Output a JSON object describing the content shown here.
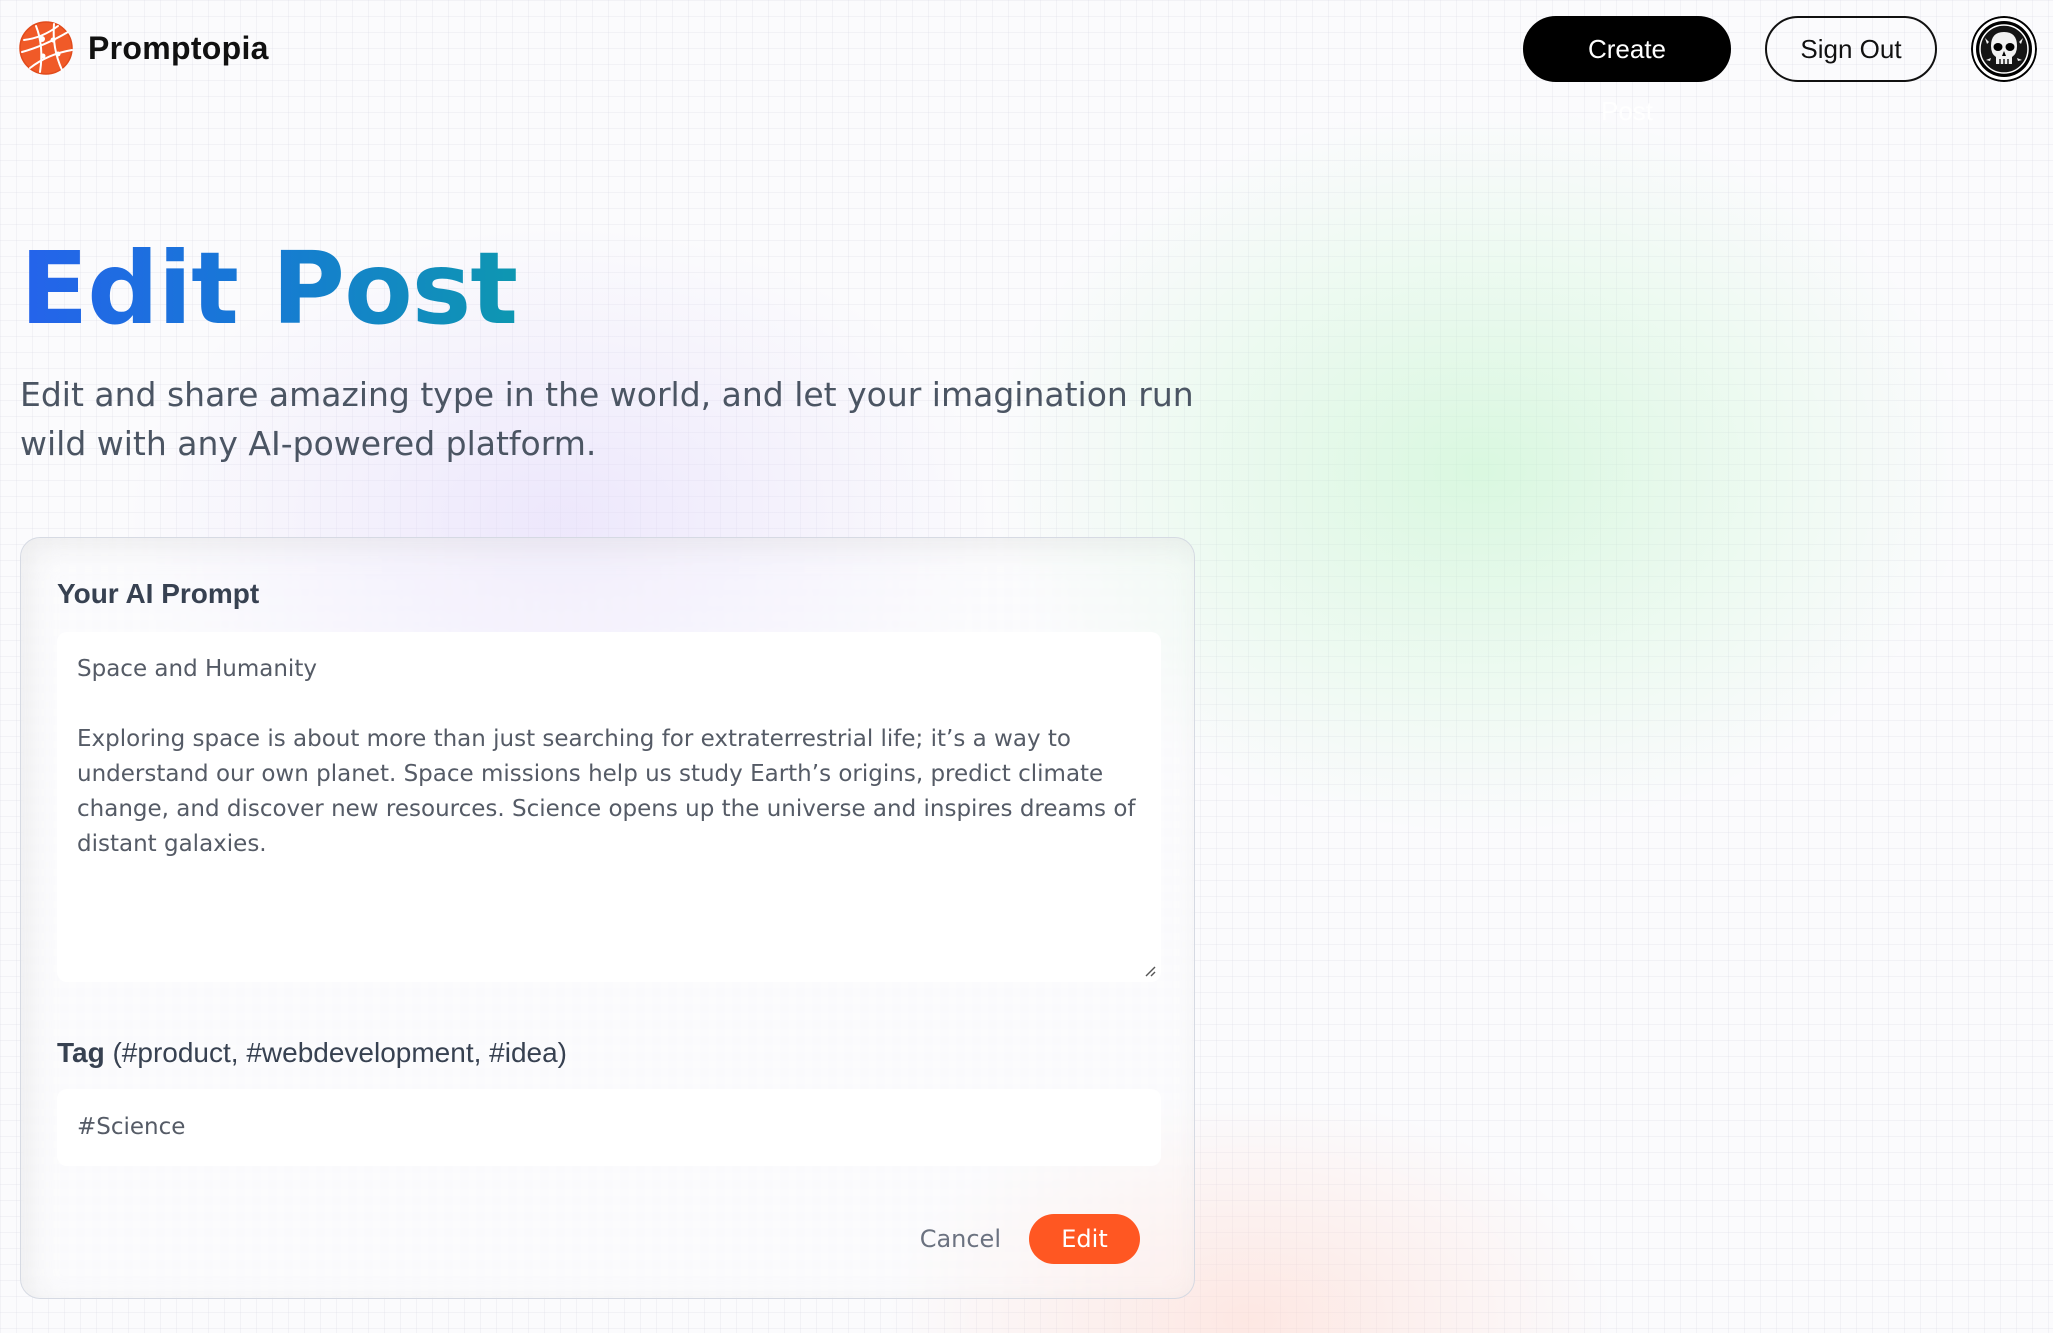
{
  "header": {
    "brand_name": "Promptopia",
    "logo_icon": "globe-network-icon",
    "create_post_label": "Create Post",
    "sign_out_label": "Sign Out",
    "avatar_icon": "skull-avatar-icon"
  },
  "hero": {
    "title": "Edit Post",
    "description": "Edit and share amazing type in the world, and let your imagination run wild with any AI-powered platform."
  },
  "form": {
    "prompt_label": "Your AI Prompt",
    "prompt_value": "Space and Humanity\n\nExploring space is about more than just searching for extraterrestrial life; it’s a way to understand our own planet. Space missions help us study Earth’s origins, predict climate change, and discover new resources. Science opens up the universe and inspires dreams of distant galaxies.",
    "tag_label_bold": "Tag",
    "tag_label_hint": "(#product, #webdevelopment, #idea)",
    "tag_value": "#Science",
    "cancel_label": "Cancel",
    "submit_label": "Edit"
  },
  "colors": {
    "title_gradient_start": "#2563eb",
    "title_gradient_end": "#0e97b1",
    "primary_orange": "#ff5722",
    "button_black": "#000000"
  }
}
